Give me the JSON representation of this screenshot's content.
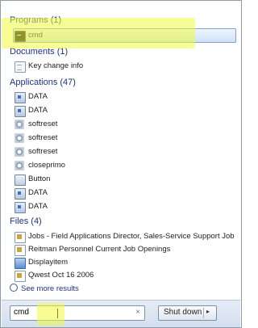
{
  "search": {
    "value": "cmd",
    "clear_icon": "×"
  },
  "shutdown": {
    "label": "Shut down",
    "arrow": "▸"
  },
  "see_more": "See more results",
  "sections": {
    "programs": {
      "title": "Programs (1)",
      "items": [
        {
          "label": "cmd",
          "icon": "cmd-icon"
        }
      ]
    },
    "documents": {
      "title": "Documents (1)",
      "items": [
        {
          "label": "Key change info",
          "icon": "document-icon"
        }
      ]
    },
    "applications": {
      "title": "Applications (47)",
      "items": [
        {
          "label": "DATA",
          "icon": "application-icon"
        },
        {
          "label": "DATA",
          "icon": "application-icon"
        },
        {
          "label": "softreset",
          "icon": "gear-icon"
        },
        {
          "label": "softreset",
          "icon": "gear-icon"
        },
        {
          "label": "softreset",
          "icon": "gear-icon"
        },
        {
          "label": "closeprimo",
          "icon": "gear-icon"
        },
        {
          "label": "Button",
          "icon": "button-icon"
        },
        {
          "label": "DATA",
          "icon": "application-icon"
        },
        {
          "label": "DATA",
          "icon": "application-icon"
        }
      ]
    },
    "files": {
      "title": "Files (4)",
      "items": [
        {
          "label": "Jobs - Field Applications Director, Sales-Service Support Job",
          "icon": "file-icon"
        },
        {
          "label": "Reitman Personnel  Current Job Openings",
          "icon": "file-icon"
        },
        {
          "label": "Displayitem",
          "icon": "display-icon"
        },
        {
          "label": "Qwest Oct 16 2006",
          "icon": "file-icon"
        }
      ]
    }
  },
  "colors": {
    "heading": "#1e3287",
    "highlight": "#f0fc3c",
    "selection": "#cfe1f7"
  }
}
